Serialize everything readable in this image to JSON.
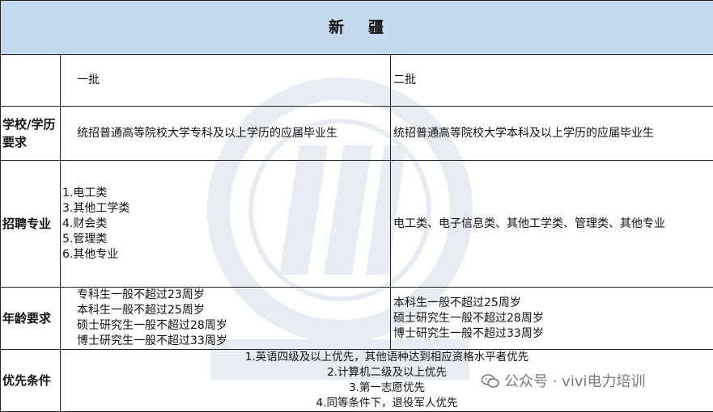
{
  "header": {
    "title_chars": [
      "新",
      "疆"
    ]
  },
  "columns": {
    "first": "一批",
    "second": "二批"
  },
  "rows": {
    "education": {
      "label": "学校/学历要求",
      "first": "统招普通高等院校大学专科及以上学历的应届毕业生",
      "second": "统招普通高等院校大学本科及以上学历的应届毕业生"
    },
    "majors": {
      "label": "招聘专业",
      "first": [
        "1.电工类",
        "3.其他工学类",
        "4.财会类",
        "5.管理类",
        "6.其他专业"
      ],
      "second": "电工类、电子信息类、其他工学类、管理类、其他专业"
    },
    "age": {
      "label": "年龄要求",
      "first": [
        "专科生一般不超过23周岁",
        "本科生一般不超过25周岁",
        "硕士研究生一般不超过28周岁",
        "博士研究生一般不超过33周岁"
      ],
      "second": [
        "本科生一般不超过25周岁",
        "硕士研究生一般不超过28周岁",
        "博士研究生一般不超过33周岁"
      ]
    },
    "priority": {
      "label": "优先条件",
      "items": [
        "1.英语四级及以上优先，其他语种达到相应资格水平者优先",
        "2.计算机二级及以上优先",
        "3.第一志愿优先",
        "4.同等条件下，退役军人优先"
      ]
    }
  },
  "watermark": {
    "text": "公众号 · vivi电力培训",
    "icon": "wechat-icon"
  },
  "background_logo": {
    "icon": "vivi-power-training-logo"
  }
}
